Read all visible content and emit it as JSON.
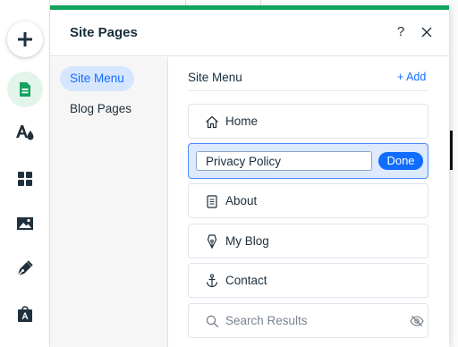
{
  "panel": {
    "title": "Site Pages",
    "help_label": "?",
    "accent_color": "#12a35d"
  },
  "tabs": [
    {
      "label": "Site Menu",
      "active": true
    },
    {
      "label": "Blog Pages",
      "active": false
    }
  ],
  "section": {
    "title": "Site Menu",
    "add_label": "+ Add"
  },
  "pages": [
    {
      "label": "Home",
      "icon": "home-icon"
    },
    {
      "label": "Privacy Policy",
      "icon": "",
      "editing": true
    },
    {
      "label": "About",
      "icon": "page-icon"
    },
    {
      "label": "My Blog",
      "icon": "blog-pen-icon"
    },
    {
      "label": "Contact",
      "icon": "anchor-icon"
    },
    {
      "label": "Search Results",
      "icon": "search-icon",
      "hidden": true
    }
  ],
  "rename": {
    "value": "Privacy Policy",
    "done_label": "Done"
  },
  "rail": [
    {
      "icon": "add-icon"
    },
    {
      "icon": "pages-icon",
      "active": true
    },
    {
      "icon": "design-icon"
    },
    {
      "icon": "apps-icon"
    },
    {
      "icon": "media-icon"
    },
    {
      "icon": "blog-icon"
    },
    {
      "icon": "store-icon"
    }
  ],
  "colors": {
    "link_blue": "#116dff",
    "active_tab_bg": "#d6e6fe",
    "pages_rail_bg": "#e3f5ea"
  }
}
